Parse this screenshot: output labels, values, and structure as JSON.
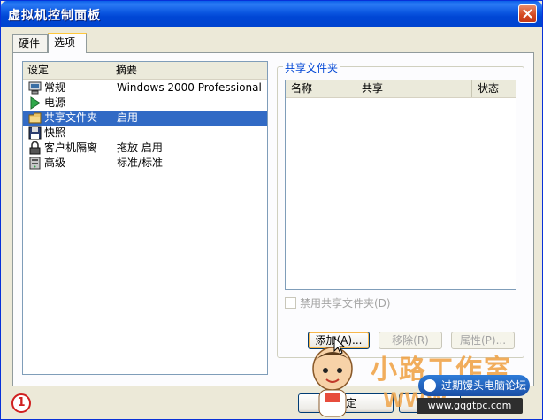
{
  "window": {
    "title": "虚拟机控制面板"
  },
  "tabs": [
    {
      "label": "硬件"
    },
    {
      "label": "选项"
    }
  ],
  "settings": {
    "headers": {
      "setting": "设定",
      "summary": "摘要"
    },
    "items": [
      {
        "name": "常规",
        "summary": "Windows 2000 Professional",
        "icon": "computer-icon"
      },
      {
        "name": "电源",
        "summary": "",
        "icon": "play-icon"
      },
      {
        "name": "共享文件夹",
        "summary": "启用",
        "icon": "folder-icon",
        "selected": true
      },
      {
        "name": "快照",
        "summary": "",
        "icon": "floppy-icon"
      },
      {
        "name": "客户机隔离",
        "summary": "拖放 启用",
        "icon": "lock-icon"
      },
      {
        "name": "高级",
        "summary": "标准/标准",
        "icon": "server-icon"
      }
    ]
  },
  "shared": {
    "group_label": "共享文件夹",
    "headers": {
      "name": "名称",
      "share": "共享",
      "status": "状态"
    },
    "disable_label": "禁用共享文件夹(D)",
    "buttons": {
      "add": "添加(A)...",
      "remove": "移除(R)",
      "properties": "属性(P)..."
    }
  },
  "footer": {
    "ok": "确定",
    "marker": "1"
  },
  "watermark": {
    "brand": "小路工作室",
    "forum": "过期馒头电脑论坛",
    "url": "www.gqgtpc.com",
    "www": "WWW"
  },
  "colors": {
    "titlebar": "#0054e3",
    "selection": "#316ac5",
    "group_label": "#0046d5"
  }
}
